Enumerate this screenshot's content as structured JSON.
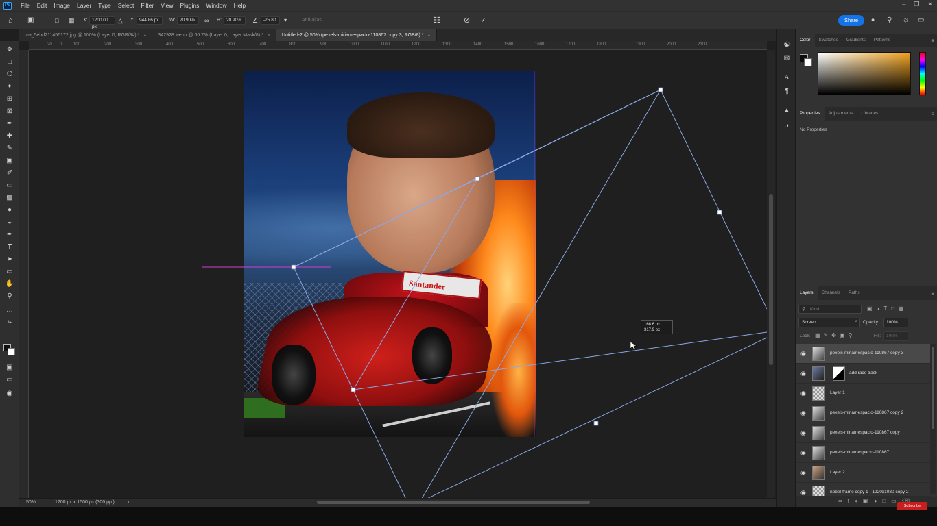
{
  "app": {
    "logo": "Ps"
  },
  "menu": [
    "File",
    "Edit",
    "Image",
    "Layer",
    "Type",
    "Select",
    "Filter",
    "View",
    "Plugins",
    "Window",
    "Help"
  ],
  "options": {
    "x_label": "X:",
    "x_value": "1200.00 px",
    "y_label": "Y:",
    "y_value": "944.86 px",
    "w_label": "W:",
    "w_value": "20.90%",
    "h_label": "H:",
    "h_value": "20.90%",
    "angle_value": "-25.80",
    "antialias": "Anti-alias",
    "share": "Share"
  },
  "tabs": [
    {
      "label": "ma_5ebd211456172.jpg @ 100% (Layer 0, RGB/8#) *",
      "active": false
    },
    {
      "label": "342928.webp @ 66.7% (Layer 0, Layer Mask/8) *",
      "active": false
    },
    {
      "label": "Untitled-2 @ 50% (pexels-miriamespacio-110867 copy 3, RGB/8) *",
      "active": true
    }
  ],
  "ruler_ticks": [
    "20",
    "0",
    "100",
    "200",
    "300",
    "400",
    "500",
    "600",
    "700",
    "800",
    "900",
    "1000",
    "1100",
    "1200",
    "1300",
    "1400",
    "1500",
    "1600",
    "1700",
    "1800",
    "1900",
    "2000",
    "2100"
  ],
  "artwork": {
    "wing_text": "Santander"
  },
  "transform_readout": {
    "line1": "166.6 px",
    "line2": "317.9 px"
  },
  "status": {
    "zoom": "50%",
    "doc_info": "1200 px x 1500 px (300 ppi)"
  },
  "color_panel": {
    "tabs": [
      "Color",
      "Swatches",
      "Gradients",
      "Patterns"
    ]
  },
  "properties_panel": {
    "tabs": [
      "Properties",
      "Adjustments",
      "Libraries"
    ],
    "empty_text": "No Properties"
  },
  "layers_panel": {
    "tabs": [
      "Layers",
      "Channels",
      "Paths"
    ],
    "search_placeholder": "Kind",
    "blend_mode": "Screen",
    "opacity_label": "Opacity:",
    "opacity_value": "100%",
    "lock_label": "Lock:",
    "fill_label": "Fill:",
    "fill_value": "100%",
    "layers": [
      {
        "name": "pexels-miriamespacio-110867 copy 3",
        "selected": true,
        "has_mask": false
      },
      {
        "name": "add race track",
        "selected": false,
        "has_mask": true
      },
      {
        "name": "Layer 1",
        "selected": false,
        "has_mask": false
      },
      {
        "name": "pexels-miriamespacio-110867 copy 2",
        "selected": false,
        "has_mask": false
      },
      {
        "name": "pexels-miriamespacio-110867 copy",
        "selected": false,
        "has_mask": false
      },
      {
        "name": "pexels-miriamespacio-110867",
        "selected": false,
        "has_mask": false
      },
      {
        "name": "Layer 2",
        "selected": false,
        "has_mask": false
      },
      {
        "name": "nobel-frame copy 1 - 1920x1080 copy 2",
        "selected": false,
        "has_mask": false
      }
    ]
  },
  "overlay_badge": "Subscribe"
}
